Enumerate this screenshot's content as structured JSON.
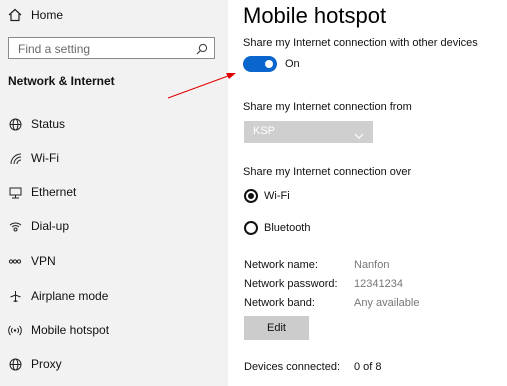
{
  "sidebar": {
    "home_label": "Home",
    "search_placeholder": "Find a setting",
    "section_title": "Network & Internet",
    "items": [
      {
        "label": "Status",
        "icon": "globe-icon"
      },
      {
        "label": "Wi-Fi",
        "icon": "wifi-icon"
      },
      {
        "label": "Ethernet",
        "icon": "ethernet-icon"
      },
      {
        "label": "Dial-up",
        "icon": "dialup-icon"
      },
      {
        "label": "VPN",
        "icon": "vpn-icon"
      },
      {
        "label": "Airplane mode",
        "icon": "airplane-icon"
      },
      {
        "label": "Mobile hotspot",
        "icon": "hotspot-icon"
      },
      {
        "label": "Proxy",
        "icon": "globe-icon"
      }
    ]
  },
  "main": {
    "title": "Mobile hotspot",
    "share_label": "Share my Internet connection with other devices",
    "toggle_state": "On",
    "share_from_label": "Share my Internet connection from",
    "share_from_value": "KSP",
    "share_over_label": "Share my Internet connection over",
    "options": [
      {
        "label": "Wi-Fi",
        "selected": true
      },
      {
        "label": "Bluetooth",
        "selected": false
      }
    ],
    "network_name_label": "Network name:",
    "network_name_value": "Nanfon",
    "network_password_label": "Network password:",
    "network_password_value": "12341234",
    "network_band_label": "Network band:",
    "network_band_value": "Any available",
    "edit_label": "Edit",
    "devices_label": "Devices connected:",
    "devices_value": "0 of 8"
  },
  "colors": {
    "accent": "#0a66cc",
    "sidebar_bg": "#f2f2f2",
    "annotation_arrow": "#e00000"
  }
}
